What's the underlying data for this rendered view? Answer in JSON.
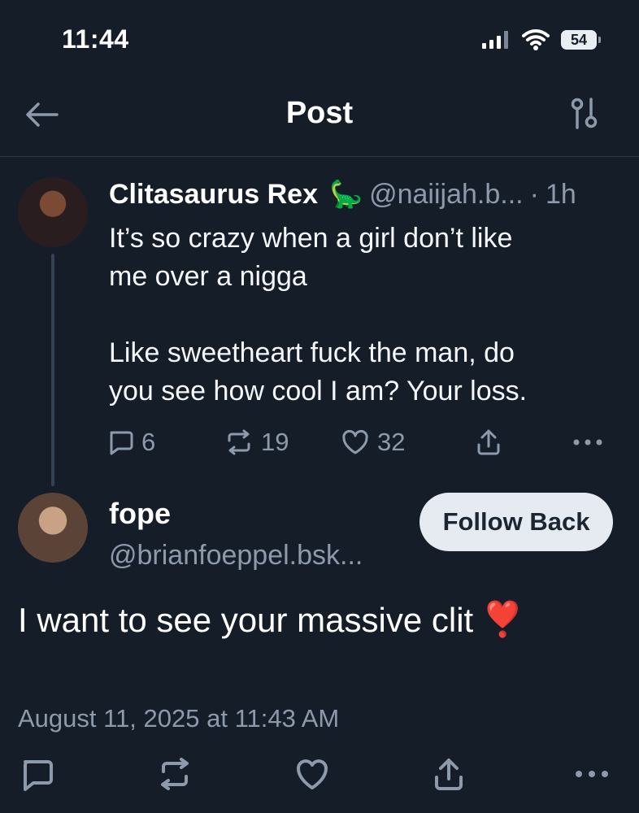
{
  "status_bar": {
    "time": "11:44",
    "battery": "54"
  },
  "header": {
    "title": "Post"
  },
  "parent_post": {
    "display_name": "Clitasaurus Rex",
    "emoji": "🦕",
    "handle": "@naiijah.b...",
    "dot": "·",
    "age": "1h",
    "text": "It’s so crazy when a girl don’t like\nme over a nigga\n\nLike sweetheart fuck the man, do\nyou see how cool I am? Your loss.",
    "reply_count": "6",
    "repost_count": "19",
    "like_count": "32"
  },
  "reply_post": {
    "display_name": "fope",
    "handle": "@brianfoeppel.bsk...",
    "follow_button": "Follow Back",
    "text": "I want to see your massive clit",
    "emoji": "❣️",
    "timestamp": "August 11, 2025 at 11:43 AM"
  },
  "colors": {
    "background": "#151d28",
    "secondary_text": "#8d9aac",
    "thread_line": "#334256",
    "follow_button": "#e6ebf1"
  },
  "icons": {
    "back": "arrow-left-icon",
    "filter": "filter-icon",
    "reply": "comment-icon",
    "repost": "repost-icon",
    "like": "heart-icon",
    "share": "share-icon",
    "more": "more-icon"
  }
}
